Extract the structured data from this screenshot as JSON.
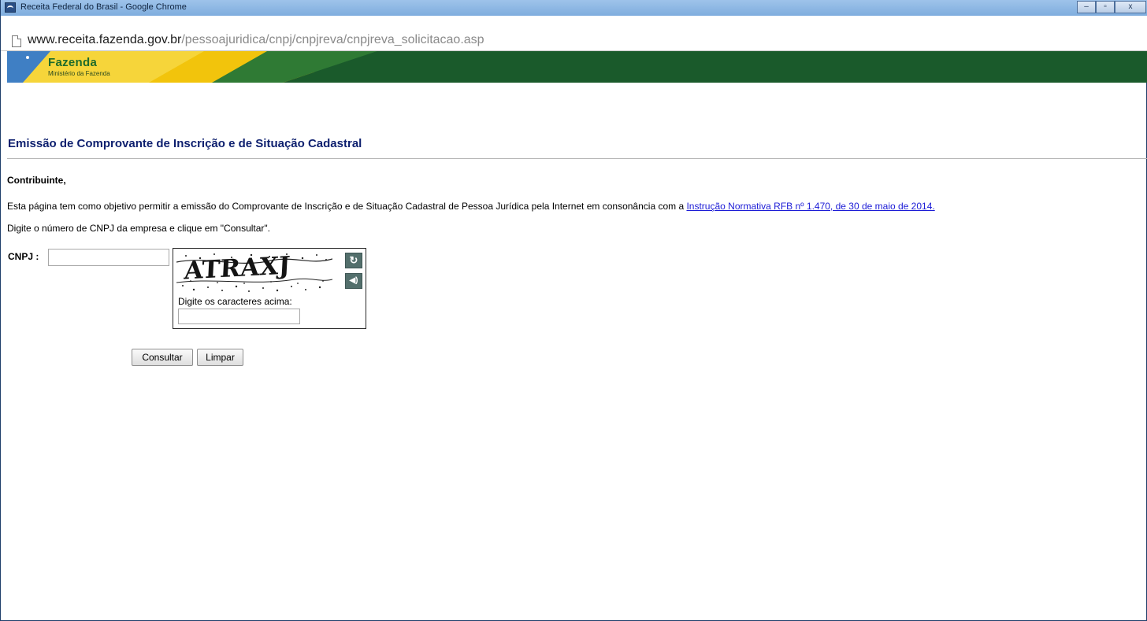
{
  "window": {
    "title": "Receita Federal do Brasil - Google Chrome",
    "controls": {
      "minimize": "–",
      "maximize": "▫",
      "close": "x"
    }
  },
  "address_bar": {
    "url_host": "www.receita.fazenda.gov.br",
    "url_path": "/pessoajuridica/cnpj/cnpjreva/cnpjreva_solicitacao.asp"
  },
  "banner": {
    "title": "Fazenda",
    "subtitle": "Ministério da Fazenda"
  },
  "page": {
    "title": "Emissão de Comprovante de Inscrição e de Situação Cadastral",
    "greeting": "Contribuinte,",
    "intro_text": "Esta página tem como objetivo permitir a emissão do Comprovante de Inscrição e de Situação Cadastral de Pessoa Jurídica pela Internet em consonância com a ",
    "intro_link": "Instrução Normativa RFB nº 1.470, de 30 de maio de 2014.",
    "instruction": "Digite o número de CNPJ da empresa e clique em \"Consultar\"."
  },
  "form": {
    "cnpj_label": "CNPJ :",
    "cnpj_value": "",
    "captcha_text": "ATRAXJ",
    "captcha_label": "Digite os caracteres acima:",
    "captcha_value": "",
    "refresh_icon": "refresh-icon",
    "audio_icon": "audio-icon",
    "consultar_label": "Consultar",
    "limpar_label": "Limpar"
  },
  "colors": {
    "title_color": "#0d1f6e",
    "link_color": "#1a1ad6",
    "banner_green": "#1a5d2d",
    "banner_yellow": "#f2c40c"
  }
}
